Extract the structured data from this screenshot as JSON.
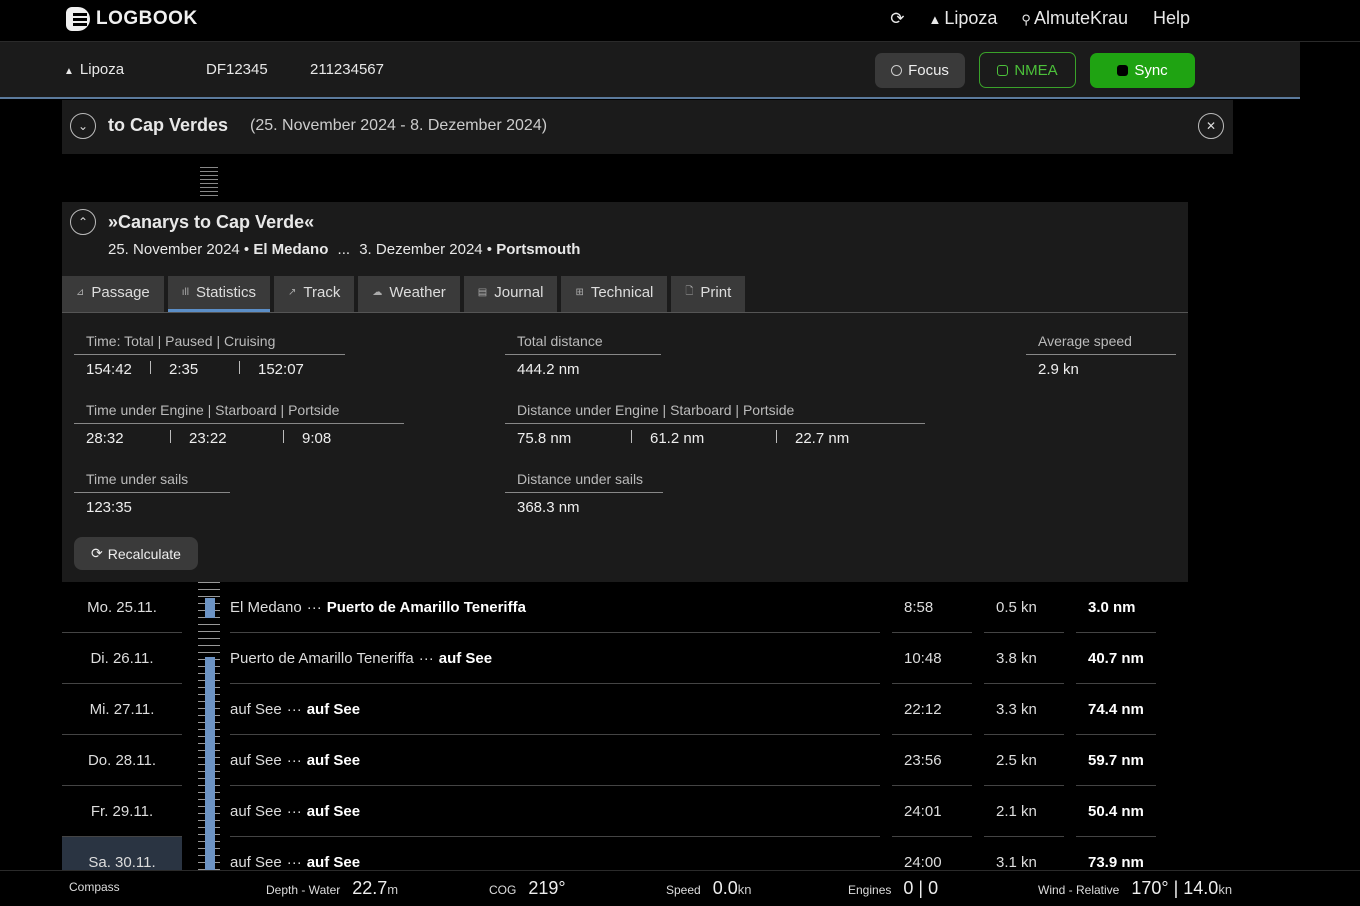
{
  "app": {
    "name": "LOGBOOK"
  },
  "topnav": {
    "vessel": "Lipoza",
    "user": "AlmuteKrau",
    "help": "Help"
  },
  "subbar": {
    "vessel": "Lipoza",
    "callsign": "DF12345",
    "mmsi": "211234567",
    "focus_label": "Focus",
    "nmea_label": "NMEA",
    "sync_label": "Sync"
  },
  "trip": {
    "title": "to Cap Verdes",
    "dates": "(25. November 2024 - 8. Dezember 2024)"
  },
  "passage": {
    "title": "»Canarys to Cap Verde«",
    "start_date": "25. November 2024",
    "start_place": "El Medano",
    "ellipsis": "...",
    "end_date": "3. Dezember 2024",
    "end_place": "Portsmouth",
    "tabs": [
      {
        "label": "Passage",
        "icon": "passage-icon"
      },
      {
        "label": "Statistics",
        "icon": "chart-icon"
      },
      {
        "label": "Track",
        "icon": "track-icon"
      },
      {
        "label": "Weather",
        "icon": "weather-icon"
      },
      {
        "label": "Journal",
        "icon": "journal-icon"
      },
      {
        "label": "Technical",
        "icon": "technical-icon"
      },
      {
        "label": "Print",
        "icon": "print-icon"
      }
    ],
    "active_tab": "Statistics"
  },
  "stats": {
    "time": {
      "label": "Time: Total | Paused | Cruising",
      "total": "154:42",
      "paused": "2:35",
      "cruising": "152:07"
    },
    "total_distance": {
      "label": "Total distance",
      "value": "444.2 nm"
    },
    "average_speed": {
      "label": "Average speed",
      "value": "2.9 kn"
    },
    "time_engine": {
      "label": "Time under Engine | Starboard | Portside",
      "total": "28:32",
      "starboard": "23:22",
      "portside": "9:08"
    },
    "distance_engine": {
      "label": "Distance under Engine | Starboard | Portside",
      "total": "75.8 nm",
      "starboard": "61.2 nm",
      "portside": "22.7 nm"
    },
    "time_sails": {
      "label": "Time under sails",
      "value": "123:35"
    },
    "distance_sails": {
      "label": "Distance under sails",
      "value": "368.3 nm"
    },
    "recalculate_label": "Recalculate"
  },
  "days": [
    {
      "date": "Mo. 25.11.",
      "from": "El Medano",
      "to": "Puerto de Amarillo Teneriffa",
      "duration": "8:58",
      "speed": "0.5 kn",
      "distance": "3.0 nm",
      "selected": false
    },
    {
      "date": "Di. 26.11.",
      "from": "Puerto de Amarillo Teneriffa",
      "to": "auf See",
      "duration": "10:48",
      "speed": "3.8 kn",
      "distance": "40.7 nm",
      "selected": false
    },
    {
      "date": "Mi. 27.11.",
      "from": "auf See",
      "to": "auf See",
      "duration": "22:12",
      "speed": "3.3 kn",
      "distance": "74.4 nm",
      "selected": false
    },
    {
      "date": "Do. 28.11.",
      "from": "auf See",
      "to": "auf See",
      "duration": "23:56",
      "speed": "2.5 kn",
      "distance": "59.7 nm",
      "selected": false
    },
    {
      "date": "Fr. 29.11.",
      "from": "auf See",
      "to": "auf See",
      "duration": "24:01",
      "speed": "2.1 kn",
      "distance": "50.4 nm",
      "selected": false
    },
    {
      "date": "Sa. 30.11.",
      "from": "auf See",
      "to": "auf See",
      "duration": "24:00",
      "speed": "3.1 kn",
      "distance": "73.9 nm",
      "selected": true
    }
  ],
  "route_separator": "···",
  "statusbar": {
    "compass": {
      "label": "Compass",
      "value": ""
    },
    "depth": {
      "label": "Depth - Water",
      "value": "22.7",
      "unit": "m"
    },
    "cog": {
      "label": "COG",
      "value": "219°"
    },
    "speed": {
      "label": "Speed",
      "value": "0.0",
      "unit": "kn"
    },
    "engines": {
      "label": "Engines",
      "value": "0 | 0"
    },
    "wind": {
      "label": "Wind - Relative",
      "value": "170° | 14.0",
      "unit": "kn"
    }
  },
  "colors": {
    "accent": "#5b8ec7",
    "sync_green": "#1fa312",
    "nmea_green": "#3aa22a",
    "timeline_blue": "#6c93c4"
  }
}
